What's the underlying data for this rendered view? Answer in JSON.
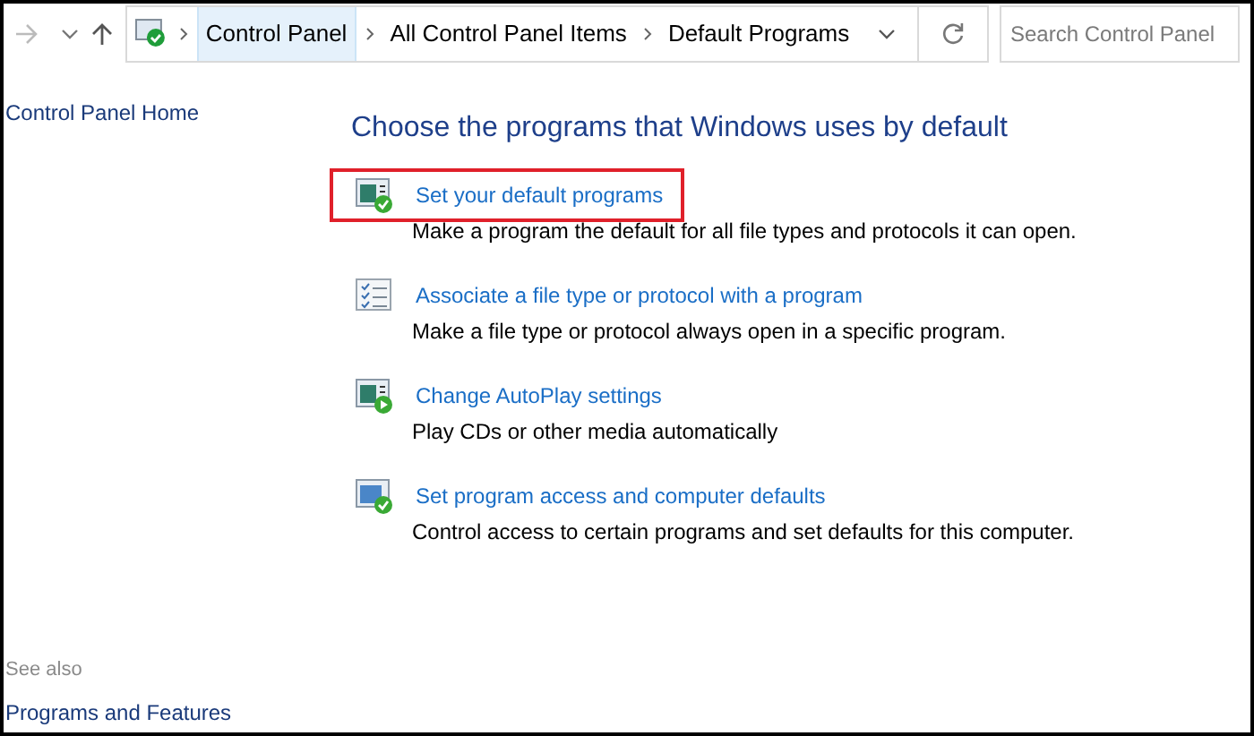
{
  "address_bar": {
    "breadcrumbs": [
      {
        "label": "Control Panel",
        "selected": true
      },
      {
        "label": "All Control Panel Items",
        "selected": false
      },
      {
        "label": "Default Programs",
        "selected": false
      }
    ],
    "search": {
      "placeholder": "Search Control Panel"
    }
  },
  "sidebar": {
    "home_link": "Control Panel Home",
    "see_also": {
      "title": "See also",
      "links": [
        "Programs and Features"
      ]
    }
  },
  "main": {
    "title": "Choose the programs that Windows uses by default",
    "items": [
      {
        "kind": "check",
        "link": "Set your default programs",
        "description": "Make a program the default for all file types and protocols it can open.",
        "highlighted": true
      },
      {
        "kind": "list",
        "link": "Associate a file type or protocol with a program",
        "description": "Make a file type or protocol always open in a specific program.",
        "highlighted": false
      },
      {
        "kind": "play",
        "link": "Change AutoPlay settings",
        "description": "Play CDs or other media automatically",
        "highlighted": false
      },
      {
        "kind": "access",
        "link": "Set program access and computer defaults",
        "description": "Control access to certain programs and set defaults for this computer.",
        "highlighted": false
      }
    ]
  }
}
